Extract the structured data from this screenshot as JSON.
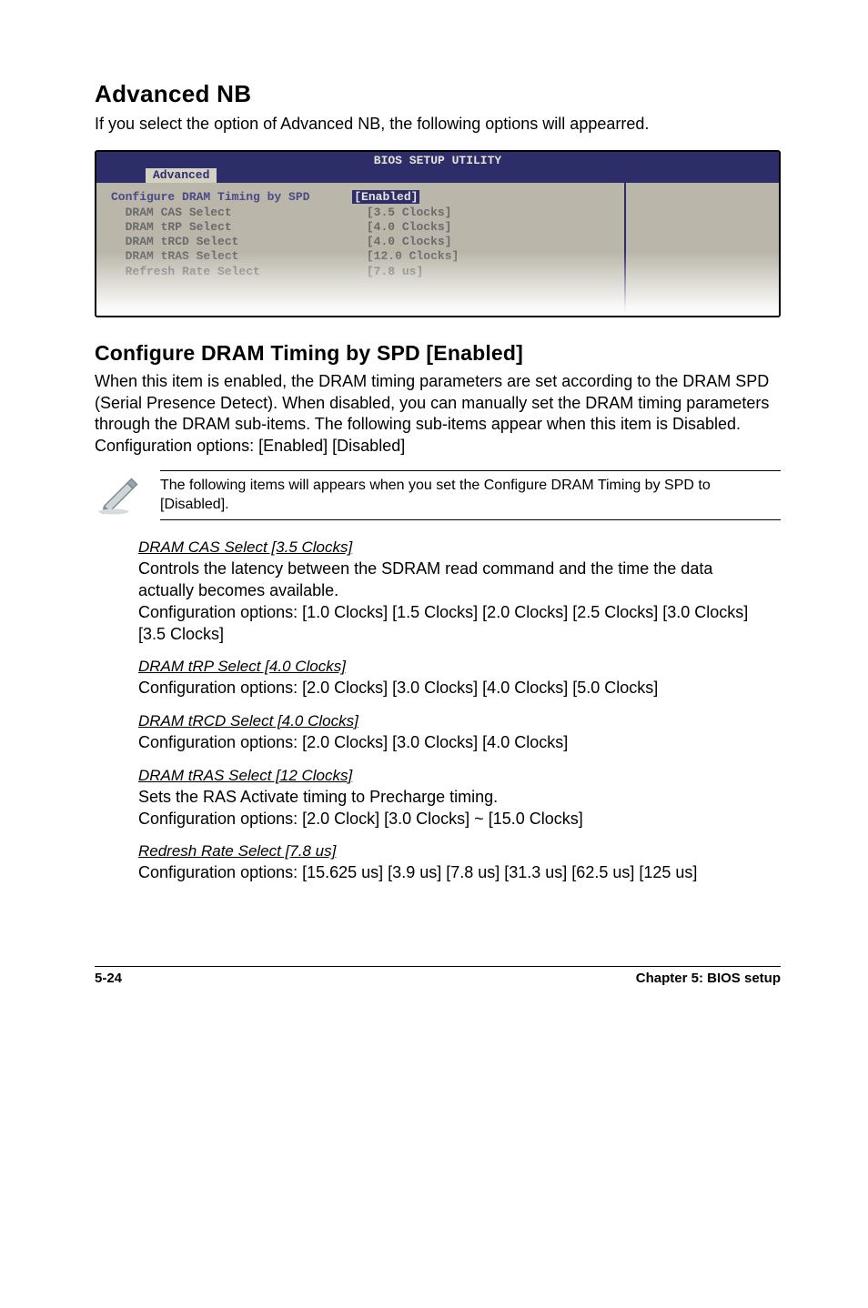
{
  "h1": "Advanced NB",
  "intro": "If you select the option of Advanced NB, the following options will appearred.",
  "bios": {
    "title": "BIOS SETUP UTILITY",
    "tab": "Advanced",
    "rows": [
      {
        "label": "Configure DRAM Timing by SPD",
        "value": "[Enabled]",
        "current": true
      },
      {
        "label": "  DRAM CAS Select",
        "value": "[3.5 Clocks]"
      },
      {
        "label": "  DRAM tRP Select",
        "value": "[4.0 Clocks]"
      },
      {
        "label": "  DRAM tRCD Select",
        "value": "[4.0 Clocks]"
      },
      {
        "label": "  DRAM tRAS Select",
        "value": "[12.0 Clocks]"
      },
      {
        "label": "  Refresh Rate Select",
        "value": "[7.8 us]"
      }
    ]
  },
  "h2": "Configure DRAM Timing by SPD [Enabled]",
  "conf_desc": "When this item is enabled, the DRAM timing parameters are set according to the DRAM SPD (Serial Presence Detect). When disabled, you can manually set the DRAM timing parameters through the DRAM sub-items. The following sub-items appear when this item is Disabled. Configuration options: [Enabled] [Disabled]",
  "note": "The following items will appears when you set the Configure DRAM Timing by SPD to [Disabled].",
  "subs": [
    {
      "head": "DRAM CAS Select [3.5 Clocks]",
      "body": "Controls the latency between the SDRAM read command and the time the data actually becomes available.\nConfiguration options: [1.0 Clocks] [1.5 Clocks] [2.0 Clocks] [2.5 Clocks] [3.0 Clocks] [3.5 Clocks]"
    },
    {
      "head": "DRAM tRP Select [4.0 Clocks]",
      "body": "Configuration options: [2.0 Clocks] [3.0 Clocks] [4.0 Clocks] [5.0 Clocks]"
    },
    {
      "head": "DRAM tRCD Select [4.0 Clocks]",
      "body": "Configuration options: [2.0 Clocks] [3.0 Clocks]  [4.0 Clocks]"
    },
    {
      "head": "DRAM tRAS Select [12 Clocks]",
      "body": "Sets the RAS Activate timing to Precharge timing.\nConfiguration options: [2.0 Clock] [3.0 Clocks] ~ [15.0 Clocks]"
    },
    {
      "head": "Redresh Rate Select [7.8 us]",
      "body": "Configuration options: [15.625 us] [3.9 us] [7.8 us] [31.3 us] [62.5 us] [125 us]"
    }
  ],
  "footer_left": "5-24",
  "footer_right": "Chapter 5: BIOS setup"
}
